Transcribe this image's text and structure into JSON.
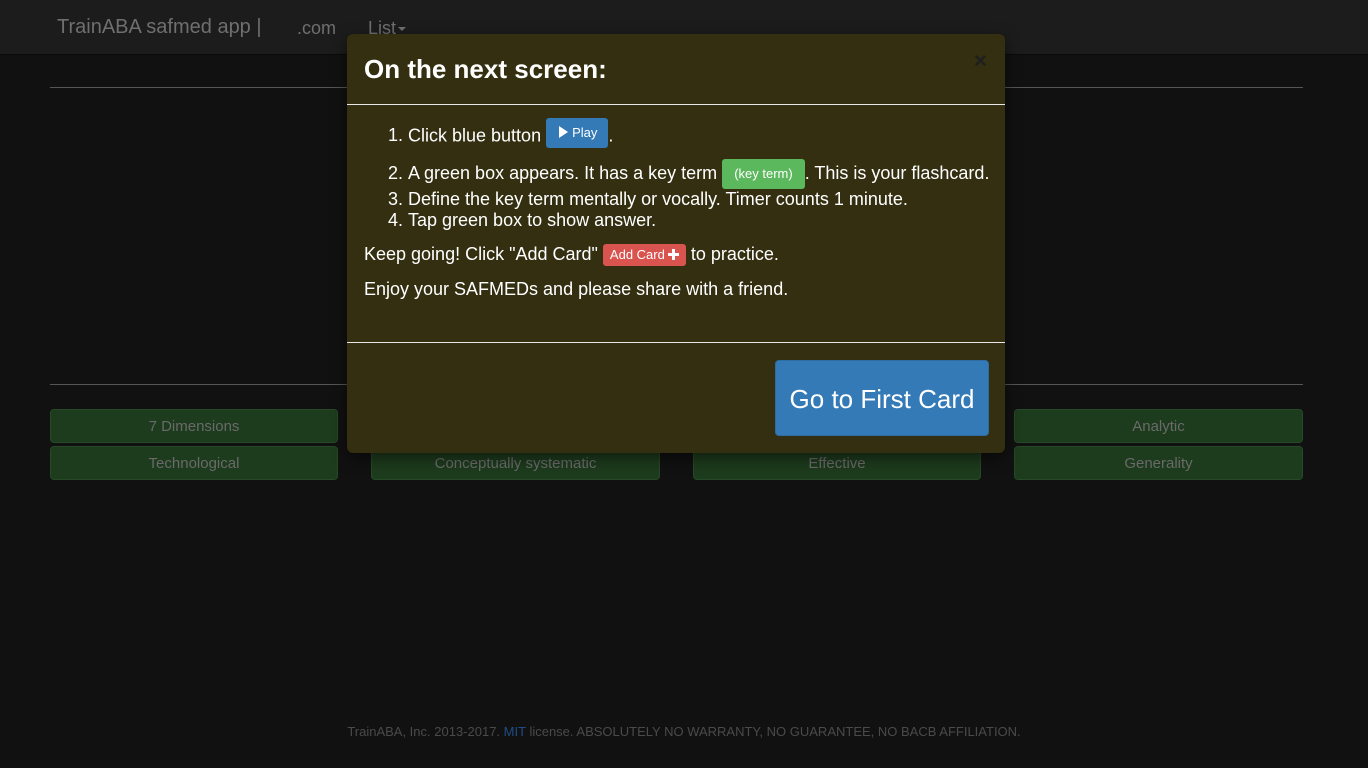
{
  "navbar": {
    "brand": "TrainABA safmed app |",
    "com_link": ".com",
    "list_link": "List"
  },
  "terms": {
    "row1": [
      "7 Dimensions",
      "Analytic"
    ],
    "row2": [
      "Technological",
      "Conceptually systematic",
      "Effective",
      "Generality"
    ]
  },
  "modal": {
    "title": "On the next screen:",
    "close": "×",
    "step1_text": "Click blue button",
    "play_label": "Play",
    "step1_end": ".",
    "step2_text": "A green box appears. It has a key term",
    "key_term_label": "(key term)",
    "step2_end": ". This is your flashcard.",
    "step3_text": "Define the key term mentally or vocally. Timer counts 1 minute.",
    "step4_text": "Tap green box to show answer.",
    "keep_going_prefix": "Keep going! Click \"Add Card\"",
    "add_card_label": "Add Card",
    "keep_going_suffix": "to practice.",
    "enjoy_text": "Enjoy your SAFMEDs and please share with a friend.",
    "go_button": "Go to First Card"
  },
  "footer": {
    "prefix": "TrainABA, Inc. 2013-2017.",
    "mit": "MIT",
    "suffix": "license. ABSOLUTELY NO WARRANTY, NO GUARANTEE, NO BACB AFFILIATION."
  },
  "colors": {
    "accent_blue": "#337ab7",
    "key_green": "#5cb85c",
    "add_red": "#d9534f",
    "modal_bg": "#332f10"
  }
}
